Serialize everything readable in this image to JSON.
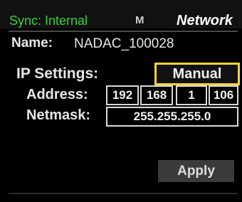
{
  "header": {
    "sync_label": "Sync: Internal",
    "mode_letter": "M",
    "active_tab": "Network"
  },
  "device": {
    "name_label": "Name:",
    "name_value": "NADAC_100028"
  },
  "ip_settings": {
    "label": "IP Settings:",
    "mode_value": "Manual"
  },
  "address": {
    "label": "Address:",
    "octets": [
      "192",
      "168",
      "1",
      "106"
    ]
  },
  "netmask": {
    "label": "Netmask:",
    "value": "255.255.255.0"
  },
  "actions": {
    "apply_label": "Apply"
  },
  "colors": {
    "sync_green": "#35d13a",
    "selection_yellow": "#f6d33b",
    "background": "#000000",
    "button_gray": "#3b3b3b"
  }
}
